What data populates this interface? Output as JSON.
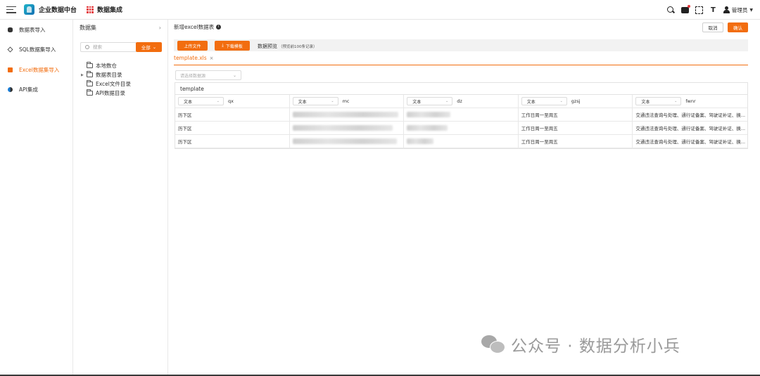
{
  "header": {
    "app_title": "企业数据中台",
    "module_title": "数据集成",
    "user_name": "管理员"
  },
  "nav": {
    "items": [
      {
        "label": "数据表导入",
        "icon": "database-icon",
        "active": false
      },
      {
        "label": "SQL数据集导入",
        "icon": "layers-icon",
        "active": false
      },
      {
        "label": "Excel数据集导入",
        "icon": "excel-icon",
        "active": true
      },
      {
        "label": "API集成",
        "icon": "api-icon",
        "active": false
      }
    ]
  },
  "dataset_panel": {
    "title": "数据集",
    "search_placeholder": "搜索",
    "filter_label": "全部",
    "tree": [
      {
        "label": "本地数仓",
        "expandable": false
      },
      {
        "label": "数据表目录",
        "expandable": true
      },
      {
        "label": "Excel文件目录",
        "expandable": false
      },
      {
        "label": "API数据目录",
        "expandable": false
      }
    ]
  },
  "main": {
    "title": "新增excel数据表",
    "cancel_label": "取消",
    "confirm_label": "确认",
    "upload_label": "上传文件",
    "download_label": "下载模板",
    "preview_label": "数据预览",
    "preview_note": "（预览前100条记录）",
    "tab_label": "template.xls",
    "sheet_placeholder": "请选择数据源",
    "grid_name": "template",
    "columns": [
      {
        "type": "文本",
        "name": "qx"
      },
      {
        "type": "文本",
        "name": "mc"
      },
      {
        "type": "文本",
        "name": "dz"
      },
      {
        "type": "文本",
        "name": "gzsj"
      },
      {
        "type": "文本",
        "name": "fwnr"
      }
    ],
    "rows": [
      {
        "qx": "历下区",
        "mc": "",
        "dz": "",
        "gzsj": "工作日周一至周五",
        "fwnr": "交通违法查询与处理、通行证备案、驾驶证补证、换..."
      },
      {
        "qx": "历下区",
        "mc": "",
        "dz": "",
        "gzsj": "工作日周一至周五",
        "fwnr": "交通违法查询与处理、通行证备案、驾驶证补证、换..."
      },
      {
        "qx": "历下区",
        "mc": "",
        "dz": "",
        "gzsj": "工作日周一至周五",
        "fwnr": "交通违法查询与处理、通行证备案、驾驶证补证、换..."
      }
    ]
  },
  "watermark": {
    "text": "公众号 · 数据分析小兵"
  },
  "colors": {
    "accent": "#f26d0f",
    "menu_icon_red": "#e4393c"
  }
}
